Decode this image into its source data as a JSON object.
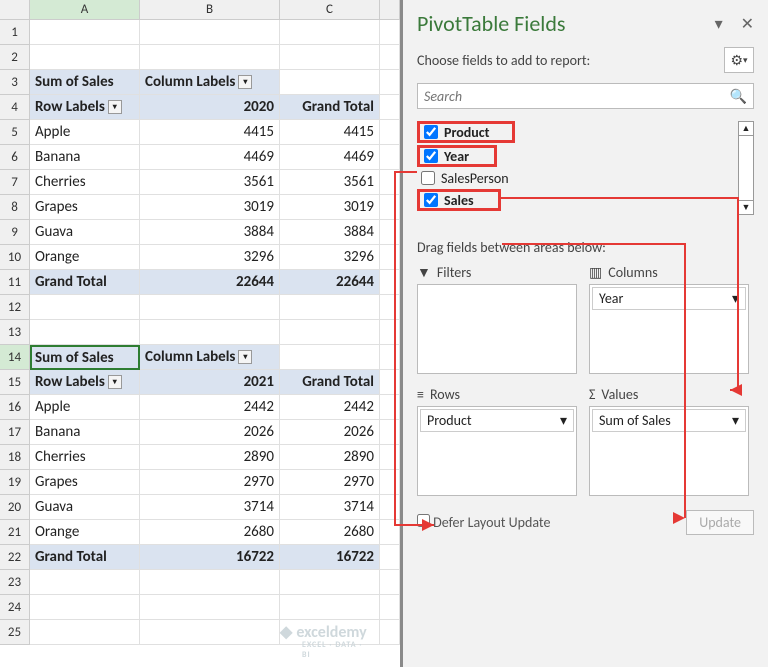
{
  "columns": [
    "A",
    "B",
    "C"
  ],
  "pivot1": {
    "measure": "Sum of Sales",
    "col_label": "Column Labels",
    "year": "2020",
    "gt_label": "Grand Total",
    "row_label": "Row Labels",
    "rows": [
      {
        "label": "Apple",
        "val": 4415,
        "gt": 4415
      },
      {
        "label": "Banana",
        "val": 4469,
        "gt": 4469
      },
      {
        "label": "Cherries",
        "val": 3561,
        "gt": 3561
      },
      {
        "label": "Grapes",
        "val": 3019,
        "gt": 3019
      },
      {
        "label": "Guava",
        "val": 3884,
        "gt": 3884
      },
      {
        "label": "Orange",
        "val": 3296,
        "gt": 3296
      }
    ],
    "total": {
      "label": "Grand Total",
      "val": 22644,
      "gt": 22644
    }
  },
  "pivot2": {
    "measure": "Sum of Sales",
    "col_label": "Column Labels",
    "year": "2021",
    "gt_label": "Grand Total",
    "row_label": "Row Labels",
    "rows": [
      {
        "label": "Apple",
        "val": 2442,
        "gt": 2442
      },
      {
        "label": "Banana",
        "val": 2026,
        "gt": 2026
      },
      {
        "label": "Cherries",
        "val": 2890,
        "gt": 2890
      },
      {
        "label": "Grapes",
        "val": 2970,
        "gt": 2970
      },
      {
        "label": "Guava",
        "val": 3714,
        "gt": 3714
      },
      {
        "label": "Orange",
        "val": 2680,
        "gt": 2680
      }
    ],
    "total": {
      "label": "Grand Total",
      "val": 16722,
      "gt": 16722
    }
  },
  "pane": {
    "title": "PivotTable Fields",
    "choose": "Choose fields to add to report:",
    "search_placeholder": "Search",
    "fields": [
      {
        "name": "Product",
        "checked": true,
        "highlight": true
      },
      {
        "name": "Year",
        "checked": true,
        "highlight": true
      },
      {
        "name": "SalesPerson",
        "checked": false,
        "highlight": false
      },
      {
        "name": "Sales",
        "checked": true,
        "highlight": true
      }
    ],
    "drag_label": "Drag fields between areas below:",
    "areas": {
      "filters": {
        "label": "Filters",
        "items": []
      },
      "columns": {
        "label": "Columns",
        "items": [
          "Year"
        ]
      },
      "rows": {
        "label": "Rows",
        "items": [
          "Product"
        ]
      },
      "values": {
        "label": "Values",
        "items": [
          "Sum of Sales"
        ]
      }
    },
    "defer": "Defer Layout Update",
    "update": "Update"
  },
  "watermark": "exceldemy",
  "watermark_sub": "EXCEL · DATA · BI"
}
